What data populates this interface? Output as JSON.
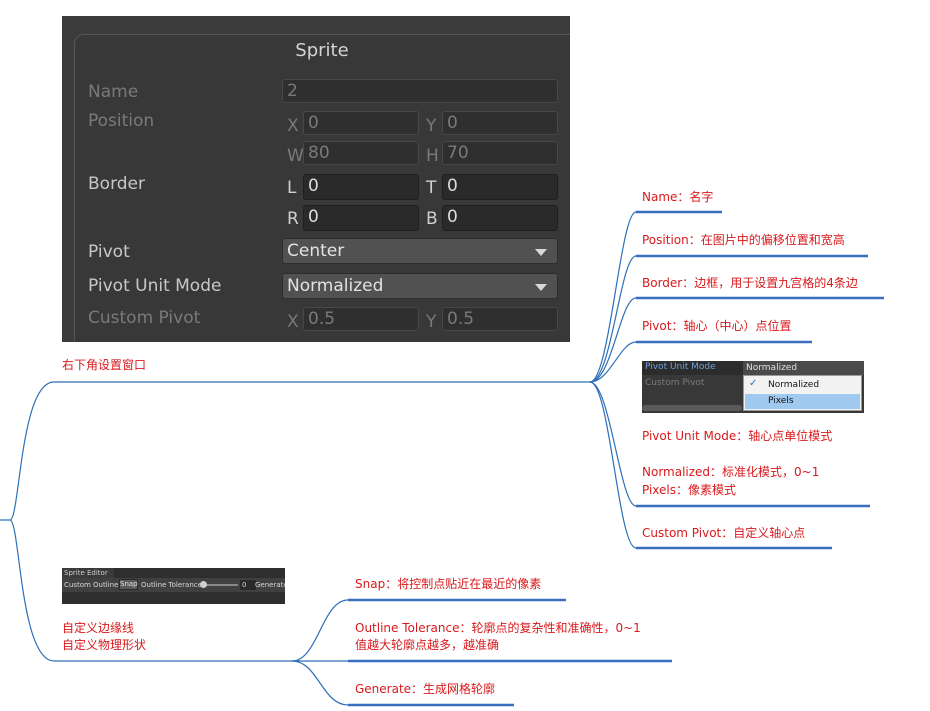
{
  "sprite_panel": {
    "title": "Sprite",
    "name_label": "Name",
    "name_value": "2",
    "position_label": "Position",
    "pos_x_prefix": "X",
    "pos_x": "0",
    "pos_y_prefix": "Y",
    "pos_y": "0",
    "pos_w_prefix": "W",
    "pos_w": "80",
    "pos_h_prefix": "H",
    "pos_h": "70",
    "border_label": "Border",
    "border_l_prefix": "L",
    "border_l": "0",
    "border_t_prefix": "T",
    "border_t": "0",
    "border_r_prefix": "R",
    "border_r": "0",
    "border_b_prefix": "B",
    "border_b": "0",
    "pivot_label": "Pivot",
    "pivot_value": "Center",
    "pivot_unit_label": "Pivot Unit Mode",
    "pivot_unit_value": "Normalized",
    "custom_pivot_label": "Custom Pivot",
    "cp_x_prefix": "X",
    "cp_x": "0.5",
    "cp_y_prefix": "Y",
    "cp_y": "0.5"
  },
  "root_branch": {
    "label": "右下角设置窗口"
  },
  "annotations": {
    "name": "Name：名字",
    "position": "Position：在图片中的偏移位置和宽高",
    "border": "Border：边框，用于设置九宫格的4条边",
    "pivot": "Pivot：轴心（中心）点位置",
    "pivot_unit_mode": "Pivot Unit Mode：轴心点单位模式",
    "normalized": "Normalized：标准化模式，0~1",
    "pixels": "Pixels：像素模式",
    "custom_pivot": "Custom Pivot：自定义轴心点"
  },
  "pivot_mode_menu": {
    "row_label": "Pivot Unit Mode",
    "custom_label": "Custom Pivot",
    "current": "Normalized",
    "options": [
      "Normalized",
      "Pixels"
    ],
    "check": "✓"
  },
  "outline_branch": {
    "line1": "自定义边缘线",
    "line2": "自定义物理形状"
  },
  "toolbar": {
    "caption": "Sprite Editor",
    "mode": "Custom Outline ▾",
    "snap": "Snap",
    "tolerance_label": "Outline Tolerance",
    "tolerance_value": "0",
    "generate": "Generate"
  },
  "outline_annotations": {
    "snap": "Snap：将控制点贴近在最近的像素",
    "tolerance_line1": "Outline Tolerance：轮廓点的复杂性和准确性，0~1",
    "tolerance_line2": "值越大轮廓点越多，越准确",
    "generate": "Generate：生成网格轮廓"
  },
  "colors": {
    "annotation_text": "#d9191c",
    "connector": "#2e6fb8",
    "underline": "#3a6fc0",
    "panel_bg": "#383838"
  }
}
